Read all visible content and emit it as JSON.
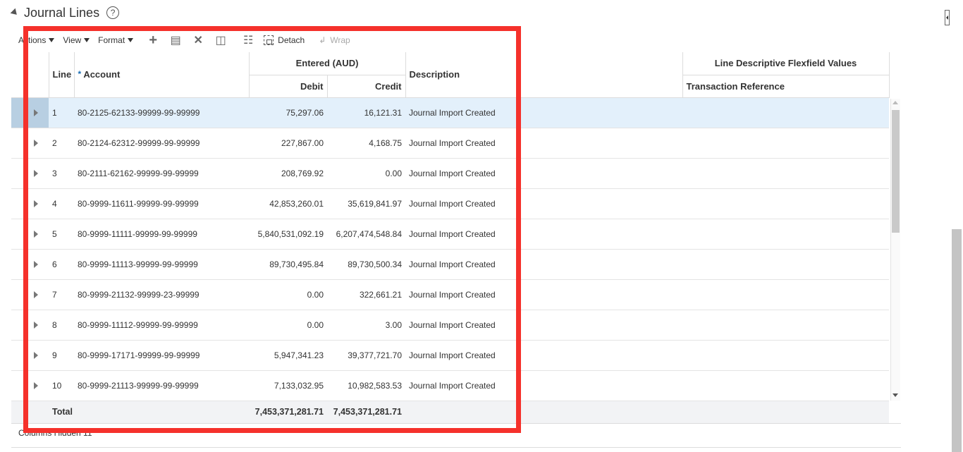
{
  "section": {
    "title": "Journal Lines",
    "help_icon": "help-icon"
  },
  "toolbar": {
    "actions_label": "Actions",
    "view_label": "View",
    "format_label": "Format",
    "detach_label": "Detach",
    "wrap_label": "Wrap",
    "icons": [
      "add-icon",
      "duplicate-icon",
      "delete-icon",
      "freeze-columns-icon",
      "query-by-example-icon",
      "detach-icon",
      "wrap-icon"
    ]
  },
  "columns": {
    "line": "Line",
    "account_required": "*",
    "account": "Account",
    "entered": "Entered (AUD)",
    "debit": "Debit",
    "credit": "Credit",
    "description": "Description",
    "flexfield": "Line Descriptive Flexfield Values",
    "transaction_reference": "Transaction Reference"
  },
  "rows": [
    {
      "line": "1",
      "account": "80-2125-62133-99999-99-99999",
      "debit": "75,297.06",
      "credit": "16,121.31",
      "description": "Journal Import Created",
      "selected": true
    },
    {
      "line": "2",
      "account": "80-2124-62312-99999-99-99999",
      "debit": "227,867.00",
      "credit": "4,168.75",
      "description": "Journal Import Created"
    },
    {
      "line": "3",
      "account": "80-2111-62162-99999-99-99999",
      "debit": "208,769.92",
      "credit": "0.00",
      "description": "Journal Import Created"
    },
    {
      "line": "4",
      "account": "80-9999-11611-99999-99-99999",
      "debit": "42,853,260.01",
      "credit": "35,619,841.97",
      "description": "Journal Import Created"
    },
    {
      "line": "5",
      "account": "80-9999-11111-99999-99-99999",
      "debit": "5,840,531,092.19",
      "credit": "6,207,474,548.84",
      "description": "Journal Import Created"
    },
    {
      "line": "6",
      "account": "80-9999-11113-99999-99-99999",
      "debit": "89,730,495.84",
      "credit": "89,730,500.34",
      "description": "Journal Import Created"
    },
    {
      "line": "7",
      "account": "80-9999-21132-99999-23-99999",
      "debit": "0.00",
      "credit": "322,661.21",
      "description": "Journal Import Created"
    },
    {
      "line": "8",
      "account": "80-9999-11112-99999-99-99999",
      "debit": "0.00",
      "credit": "3.00",
      "description": "Journal Import Created"
    },
    {
      "line": "9",
      "account": "80-9999-17171-99999-99-99999",
      "debit": "5,947,341.23",
      "credit": "39,377,721.70",
      "description": "Journal Import Created"
    },
    {
      "line": "10",
      "account": "80-9999-21113-99999-99-99999",
      "debit": "7,133,032.95",
      "credit": "10,982,583.53",
      "description": "Journal Import Created"
    }
  ],
  "total": {
    "label": "Total",
    "debit": "7,453,371,281.71",
    "credit": "7,453,371,281.71"
  },
  "footer": {
    "status": "Columns Hidden  11"
  },
  "colors": {
    "highlight_frame": "#f5312b",
    "selected_row": "#e3f0fb"
  }
}
